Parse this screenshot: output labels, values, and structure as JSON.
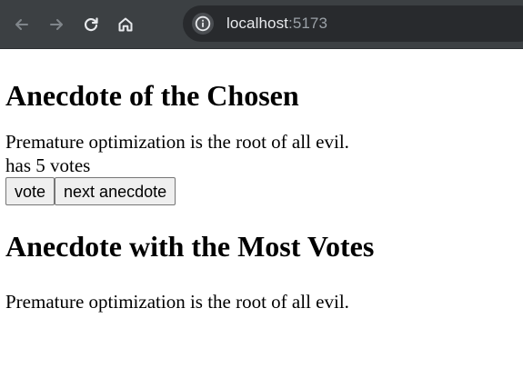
{
  "browser": {
    "url_host": "localhost",
    "url_port": ":5173",
    "icons": [
      "back-arrow-icon",
      "forward-arrow-icon",
      "reload-icon",
      "home-icon",
      "info-icon"
    ]
  },
  "page": {
    "chosen_heading": "Anecdote of the Chosen",
    "chosen_text": "Premature optimization is the root of all evil.",
    "votes_text": "has 5 votes",
    "vote_button": "vote",
    "next_button": "next anecdote",
    "most_votes_heading": "Anecdote with the Most Votes",
    "most_votes_text": "Premature optimization is the root of all evil."
  }
}
